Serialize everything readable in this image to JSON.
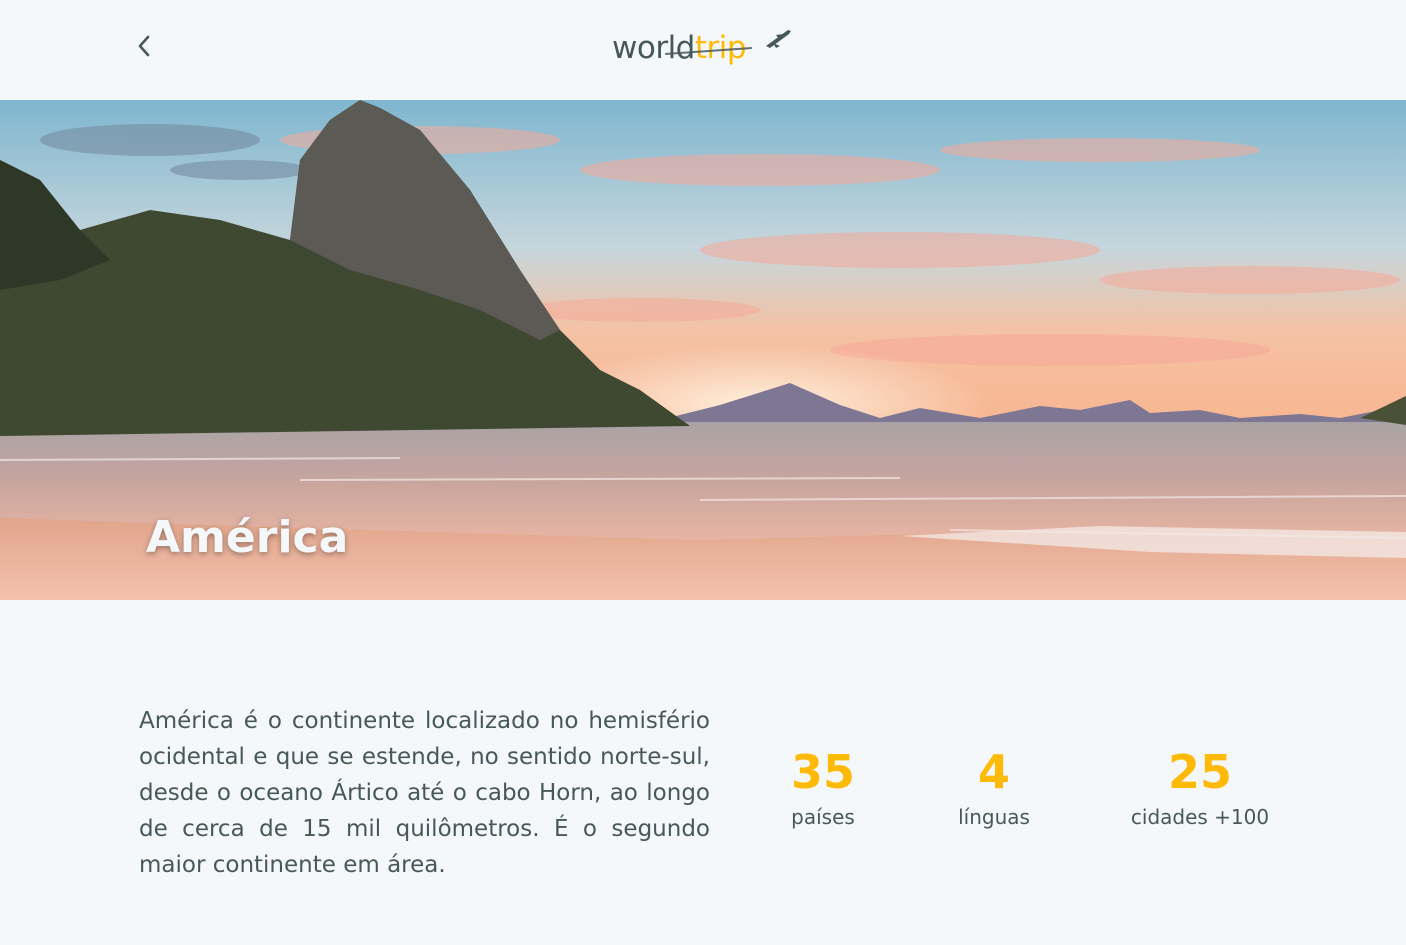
{
  "header": {
    "back_icon": "chevron-left-icon",
    "logo": {
      "word1": "world",
      "word2": "trip",
      "icon": "airplane-icon"
    }
  },
  "banner": {
    "title": "América"
  },
  "continent": {
    "description": "América é o continente localizado no hemisfério ocidental e que se estende, no sentido norte-sul, desde o oceano Ártico até o cabo Horn, ao longo de cerca de 15 mil quilômetros. É o segundo maior continente em área."
  },
  "stats": [
    {
      "value": "35",
      "label": "países"
    },
    {
      "value": "4",
      "label": "línguas"
    },
    {
      "value": "25",
      "label": "cidades +100"
    }
  ],
  "colors": {
    "accent": "#ffba08",
    "text": "#47585b",
    "background": "#f5f8fa",
    "light_text": "#f5f8fa"
  }
}
